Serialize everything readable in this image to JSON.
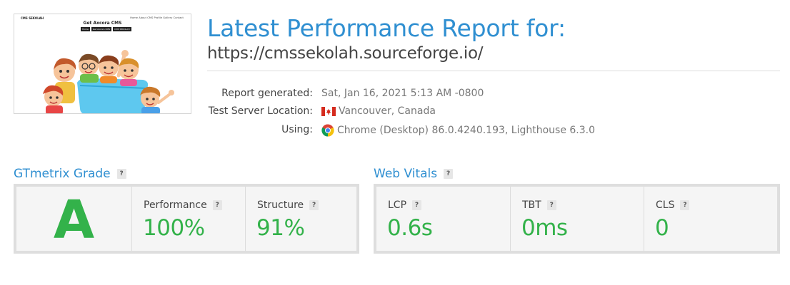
{
  "thumbnail": {
    "site_name": "CMS SEKOLAH",
    "nav": "Home  About  CMS  Profile  Gallery  Contact",
    "headline": "Get Axcora CMS",
    "buttons": [
      "Home",
      "Get Axcora CMS",
      "CMS SEKOLAH"
    ]
  },
  "report": {
    "title": "Latest Performance Report for:",
    "url": "https://cmssekolah.sourceforge.io/",
    "generated_label": "Report generated:",
    "generated_value": "Sat, Jan 16, 2021 5:13 AM -0800",
    "location_label": "Test Server Location:",
    "location_value": "Vancouver, Canada",
    "using_label": "Using:",
    "using_value": "Chrome (Desktop) 86.0.4240.193, Lighthouse 6.3.0"
  },
  "help_mark": "?",
  "grade_section": {
    "title": "GTmetrix Grade",
    "grade": "A",
    "performance_label": "Performance",
    "performance_value": "100%",
    "structure_label": "Structure",
    "structure_value": "91%"
  },
  "vitals_section": {
    "title": "Web Vitals",
    "lcp_label": "LCP",
    "lcp_value": "0.6s",
    "tbt_label": "TBT",
    "tbt_value": "0ms",
    "cls_label": "CLS",
    "cls_value": "0"
  },
  "colors": {
    "accent_blue": "#2f8fd1",
    "good_green": "#33b24a"
  },
  "icons": [
    "canada-flag-icon",
    "chrome-icon",
    "help-icon"
  ]
}
